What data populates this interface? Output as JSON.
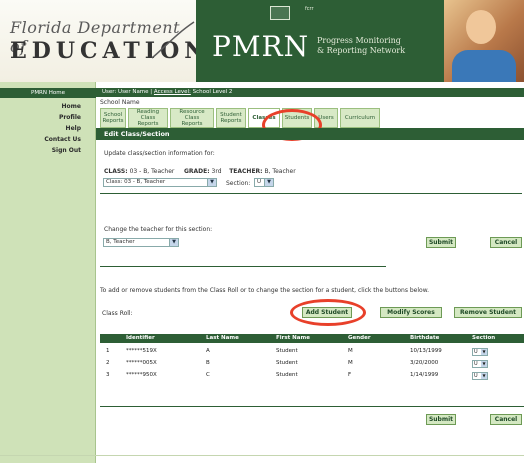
{
  "banner": {
    "logo_line1": "Florida Department of",
    "logo_line2": "EDUCATION",
    "app_name": "PMRN",
    "app_sub1": "Progress Monitoring",
    "app_sub2": "& Reporting Network",
    "partner_small": "fcrr"
  },
  "nav": {
    "header": "PMRN Home",
    "items": [
      "Home",
      "Profile",
      "Help",
      "Contact Us",
      "Sign Out"
    ]
  },
  "userbar": {
    "prefix": "User: User Name",
    "access_link": "Access Level:",
    "level": "School Level 2"
  },
  "school_name": "School Name",
  "tabs": [
    {
      "label": "School Reports"
    },
    {
      "label": "Reading Class Reports"
    },
    {
      "label": "Resource Class Reports"
    },
    {
      "label": "Student Reports"
    },
    {
      "label": "Classes"
    },
    {
      "label": "Students"
    },
    {
      "label": "Users"
    },
    {
      "label": "Curriculum"
    }
  ],
  "section_title": "Edit Class/Section",
  "update_text": "Update class/section information for:",
  "class_info": {
    "class_label": "CLASS:",
    "class_value": "03 - B, Teacher",
    "grade_label": "GRADE:",
    "grade_value": "3rd",
    "teacher_label": "TEACHER:",
    "teacher_value": "B, Teacher"
  },
  "selectors": {
    "class_label": "Class:",
    "class_value": "03 - B, Teacher",
    "section_label": "Section:",
    "section_value": "U"
  },
  "change_teacher": {
    "label": "Change the teacher for this section:",
    "value": "B, Teacher",
    "submit": "Submit",
    "cancel": "Cancel"
  },
  "roll_instructions": "To add or remove students from the Class Roll or to change the section for a student, click the buttons below.",
  "class_roll_label": "Class Roll:",
  "roll_buttons": {
    "add": "Add Student",
    "modify": "Modify Scores",
    "remove": "Remove Student"
  },
  "table": {
    "headers": [
      "Identifier",
      "Last Name",
      "First Name",
      "Gender",
      "Birthdate",
      "Section"
    ],
    "rows": [
      {
        "n": "1",
        "id": "******519X",
        "last": "A",
        "first": "Student",
        "gender": "M",
        "birth": "10/13/1999",
        "section": "U"
      },
      {
        "n": "2",
        "id": "******005X",
        "last": "B",
        "first": "Student",
        "gender": "M",
        "birth": "3/20/2000",
        "section": "U"
      },
      {
        "n": "3",
        "id": "******950X",
        "last": "C",
        "first": "Student",
        "gender": "F",
        "birth": "1/14/1999",
        "section": "U"
      }
    ]
  },
  "bottom_buttons": {
    "submit": "Submit",
    "cancel": "Cancel"
  },
  "colors": {
    "brand_green": "#2d5e35",
    "highlight_red": "#e8402a"
  }
}
